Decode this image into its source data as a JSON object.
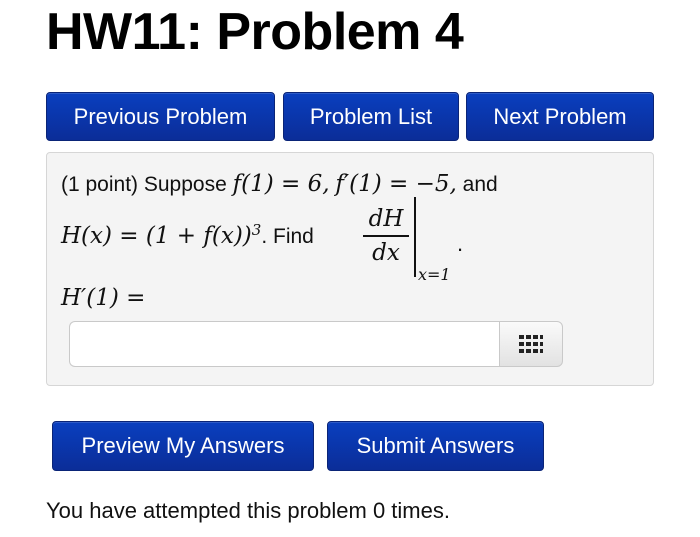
{
  "page": {
    "title": "HW11: Problem 4"
  },
  "nav": {
    "previous_label": "Previous Problem",
    "list_label": "Problem List",
    "next_label": "Next Problem"
  },
  "problem": {
    "points": "(1 point) Suppose ",
    "condition_1": "f(1) = 6,",
    "condition_2": "f′(1) = −5,",
    "and_text": "and",
    "definition": "H(x) = (1 + f(x))",
    "exponent": "3",
    "find_text": ". Find",
    "deriv_num": "dH",
    "deriv_den": "dx",
    "eval_at": "x=1",
    "period": ".",
    "answer_prompt": "H′(1) =",
    "answer_value": ""
  },
  "icons": {
    "palette": "grid-keypad-icon"
  },
  "actions": {
    "preview_label": "Preview My Answers",
    "submit_label": "Submit Answers"
  },
  "status": {
    "attempts_text": "You have attempted this problem 0 times."
  },
  "colors": {
    "button_blue": "#0b35a8",
    "panel_bg": "#f4f4f4"
  }
}
